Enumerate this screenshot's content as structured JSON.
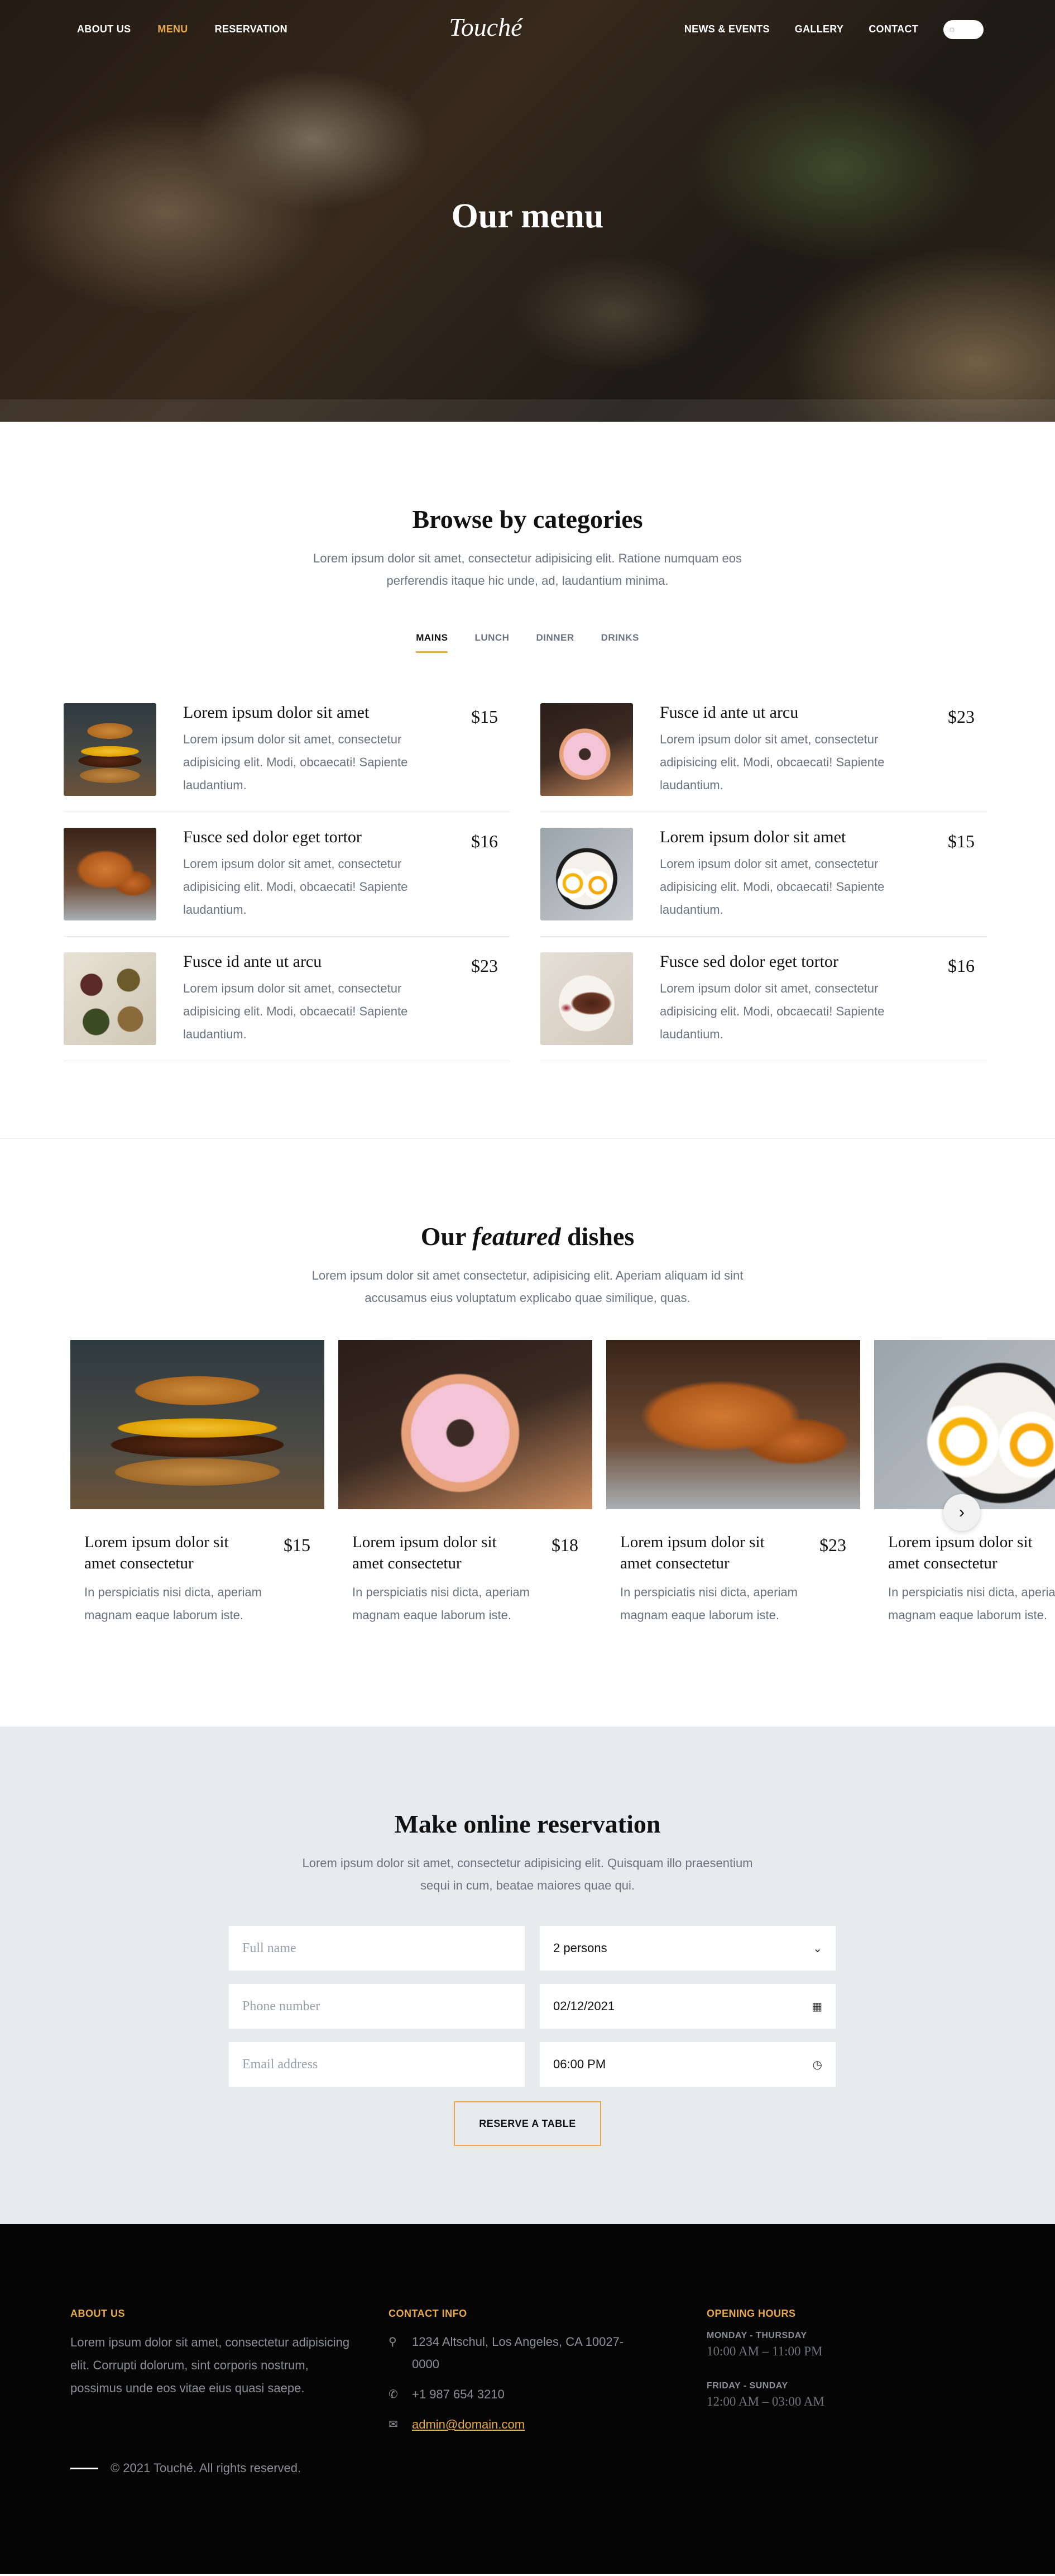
{
  "nav": {
    "left": [
      "ABOUT US",
      "MENU",
      "RESERVATION"
    ],
    "logo": "Touché",
    "right": [
      "NEWS & EVENTS",
      "GALLERY",
      "CONTACT"
    ],
    "theme_toggle_icon": "sun-icon"
  },
  "hero": {
    "title": "Our menu"
  },
  "categories": {
    "title": "Browse by categories",
    "subtitle": "Lorem ipsum dolor sit amet, consectetur adipisicing elit. Ratione numquam eos perferendis itaque hic unde, ad, laudantium minima.",
    "tabs": [
      "MAINS",
      "LUNCH",
      "DINNER",
      "DRINKS"
    ],
    "active_tab": "MAINS",
    "items": [
      {
        "name": "Lorem ipsum dolor sit amet",
        "price": "$15",
        "desc": "Lorem ipsum dolor sit amet, consectetur adipisicing elit. Modi, obcaecati! Sapiente laudantium.",
        "image": "burger"
      },
      {
        "name": "Fusce id ante ut arcu",
        "price": "$23",
        "desc": "Lorem ipsum dolor sit amet, consectetur adipisicing elit. Modi, obcaecati! Sapiente laudantium.",
        "image": "donut"
      },
      {
        "name": "Fusce sed dolor eget tortor",
        "price": "$16",
        "desc": "Lorem ipsum dolor sit amet, consectetur adipisicing elit. Modi, obcaecati! Sapiente laudantium.",
        "image": "croissant"
      },
      {
        "name": "Lorem ipsum dolor sit amet",
        "price": "$15",
        "desc": "Lorem ipsum dolor sit amet, consectetur adipisicing elit. Modi, obcaecati! Sapiente laudantium.",
        "image": "breakfast"
      },
      {
        "name": "Fusce id ante ut arcu",
        "price": "$23",
        "desc": "Lorem ipsum dolor sit amet, consectetur adipisicing elit. Modi, obcaecati! Sapiente laudantium.",
        "image": "tapas"
      },
      {
        "name": "Fusce sed dolor eget tortor",
        "price": "$16",
        "desc": "Lorem ipsum dolor sit amet, consectetur adipisicing elit. Modi, obcaecati! Sapiente laudantium.",
        "image": "steak"
      }
    ]
  },
  "featured": {
    "title_pre": "Our ",
    "title_em": "featured",
    "title_post": " dishes",
    "subtitle": "Lorem ipsum dolor sit amet consectetur, adipisicing elit. Aperiam aliquam id sint accusamus eius voluptatum explicabo quae similique, quas.",
    "cards": [
      {
        "name": "Lorem ipsum dolor sit amet consectetur",
        "price": "$15",
        "desc": "In perspiciatis nisi dicta, aperiam magnam eaque laborum iste.",
        "image": "burger"
      },
      {
        "name": "Lorem ipsum dolor sit amet consectetur",
        "price": "$18",
        "desc": "In perspiciatis nisi dicta, aperiam magnam eaque laborum iste.",
        "image": "donut"
      },
      {
        "name": "Lorem ipsum dolor sit amet consectetur",
        "price": "$23",
        "desc": "In perspiciatis nisi dicta, aperiam magnam eaque laborum iste.",
        "image": "croissant"
      },
      {
        "name": "Lorem ipsum dolor sit amet consectetur",
        "price": "",
        "desc": "In perspiciatis nisi dicta, aperiam magnam eaque laborum iste.",
        "image": "breakfast"
      }
    ],
    "next_icon": "chevron-right-icon"
  },
  "reservation": {
    "title": "Make online reservation",
    "subtitle": "Lorem ipsum dolor sit amet, consectetur adipisicing elit. Quisquam illo praesentium sequi in cum, beatae maiores quae qui.",
    "full_name_placeholder": "Full name",
    "persons_value": "2 persons",
    "phone_placeholder": "Phone number",
    "date_value": "02/12/2021",
    "email_placeholder": "Email address",
    "time_value": "06:00 PM",
    "submit_label": "RESERVE A TABLE"
  },
  "footer": {
    "about_heading": "ABOUT US",
    "about_text": "Lorem ipsum dolor sit amet, consectetur adipisicing elit. Corrupti dolorum, sint corporis nostrum, possimus unde eos vitae eius quasi saepe.",
    "contact_heading": "CONTACT INFO",
    "address": "1234 Altschul, Los Angeles, CA 10027-0000",
    "phone": "+1 987 654 3210",
    "email": "admin@domain.com",
    "hours_heading": "OPENING HOURS",
    "weekday_label": "MONDAY - THURSDAY",
    "weekday_hours": "10:00 AM – 11:00 PM",
    "weekend_label": "FRIDAY - SUNDAY",
    "weekend_hours": "12:00 AM – 03:00 AM",
    "copyright": "© 2021 Touché. All rights reserved."
  },
  "colors": {
    "accent": "#e8a94a",
    "reservation_bg": "#e8ebee",
    "footer_bg": "#050505",
    "muted_text": "#6b7380"
  }
}
